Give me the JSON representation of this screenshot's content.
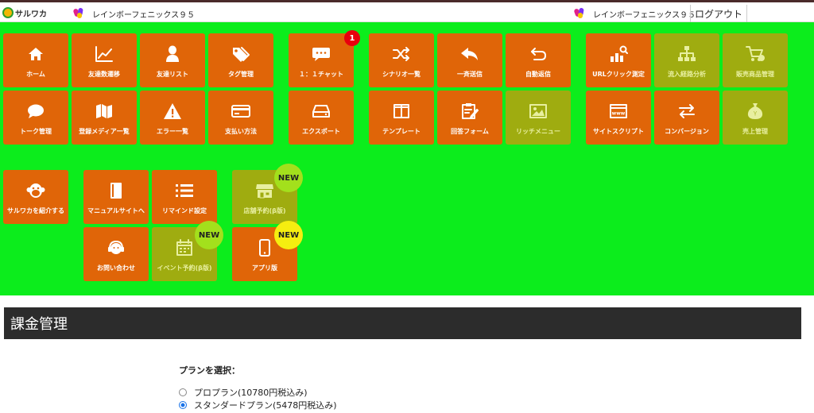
{
  "header": {
    "brand": "サルワカ",
    "account_left": "レインボーフェニックス９５",
    "account_right": "レインボーフェニックス９５",
    "logout": "ログアウト"
  },
  "menu": {
    "home": "ホーム",
    "friend_trend": "友達数遷移",
    "friend_list": "友達リスト",
    "tag_manage": "タグ管理",
    "chat": "１：１チャット",
    "chat_badge": "1",
    "scenario": "シナリオ一覧",
    "broadcast": "一斉送信",
    "auto_reply": "自動返信",
    "url_click": "URLクリック測定",
    "inflow": "流入経路分析",
    "product": "販売商品管理",
    "talk": "トーク管理",
    "media": "登録メディア一覧",
    "errors": "エラー一覧",
    "payment": "支払い方法",
    "export": "エクスポート",
    "template": "テンプレート",
    "form": "回答フォーム",
    "rich_menu": "リッチメニュー",
    "site_script": "サイトスクリプト",
    "conversion": "コンバージョン",
    "sales": "売上管理",
    "introduce": "サルワカを紹介する",
    "manual": "マニュアルサイトへ",
    "remind": "リマインド設定",
    "store_reserve": "店舗予約(β版)",
    "contact": "お問い合わせ",
    "event_reserve": "イベント予約(β版)",
    "app": "アプリ版",
    "new_label": "NEW"
  },
  "billing": {
    "title": "課金管理",
    "plan_label": "プランを選択：",
    "plans": [
      {
        "label": "プロプラン(10780円税込み)",
        "selected": false
      },
      {
        "label": "スタンダードプラン(5478円税込み)",
        "selected": true
      }
    ]
  },
  "colors": {
    "menu_bg": "#0ced1c",
    "tile_active": "#e06508",
    "tile_disabled": "#9fac10",
    "section_bar": "#2c2c2c",
    "badge_red": "#e8000d",
    "badge_new_green": "#a3e01c",
    "badge_new_yellow": "#f5ee10"
  }
}
